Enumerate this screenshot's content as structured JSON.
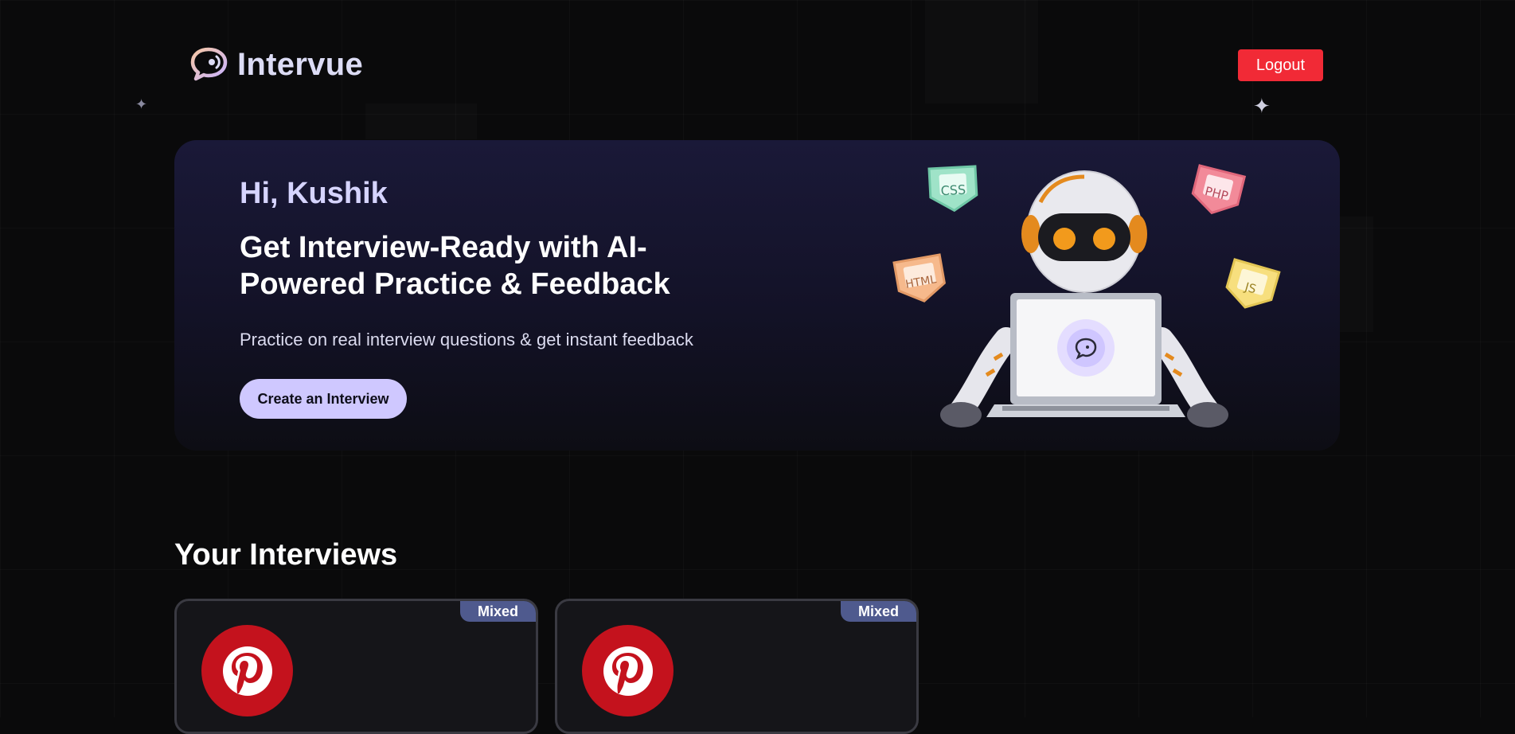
{
  "app": {
    "name": "Intervue"
  },
  "header": {
    "logout_label": "Logout"
  },
  "hero": {
    "greeting": "Hi, Kushik",
    "headline": "Get Interview-Ready with AI-Powered Practice & Feedback",
    "subtext": "Practice on real interview questions & get instant feedback",
    "cta_label": "Create an Interview",
    "badges": [
      "CSS",
      "PHP",
      "HTML",
      "JS"
    ]
  },
  "interviews": {
    "title": "Your Interviews",
    "cards": [
      {
        "badge": "Mixed",
        "icon": "pinterest-icon"
      },
      {
        "badge": "Mixed",
        "icon": "pinterest-icon"
      }
    ]
  },
  "colors": {
    "background": "#0a0a0b",
    "logout": "#f12a36",
    "cta": "#cfc8ff",
    "badge": "#4f5a8e",
    "pinterest": "#c4121d"
  }
}
